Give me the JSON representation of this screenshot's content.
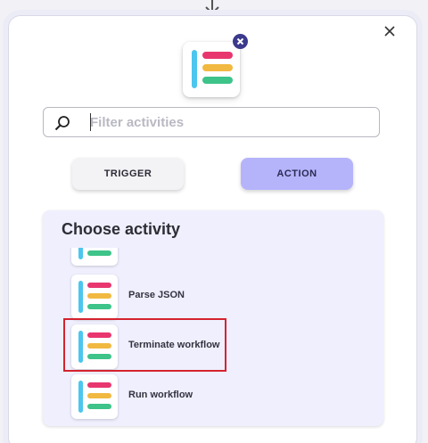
{
  "search": {
    "placeholder": "Filter activities",
    "value": ""
  },
  "type_buttons": {
    "trigger": "TRIGGER",
    "action": "ACTION",
    "selected": "action"
  },
  "activity_panel": {
    "title": "Choose activity",
    "items": [
      {
        "label": ""
      },
      {
        "label": "Parse JSON"
      },
      {
        "label": "Terminate workflow"
      },
      {
        "label": "Run workflow"
      }
    ]
  },
  "icons": {
    "top": "arrow-down-icon",
    "close": "close-icon",
    "remove_app": "remove-x-icon",
    "search": "magnifier-icon",
    "app": "activity-list-icon"
  },
  "colors": {
    "action_selected": "#b5b4fb",
    "panel_bg": "#efeffe",
    "highlight": "#d4232f",
    "logo_bar_blue": "#4cc6ee",
    "logo_bar_pink": "#e8376e",
    "logo_bar_yellow": "#f1b941",
    "logo_bar_green": "#3ec389",
    "remove_badge": "#3c3a8c"
  }
}
